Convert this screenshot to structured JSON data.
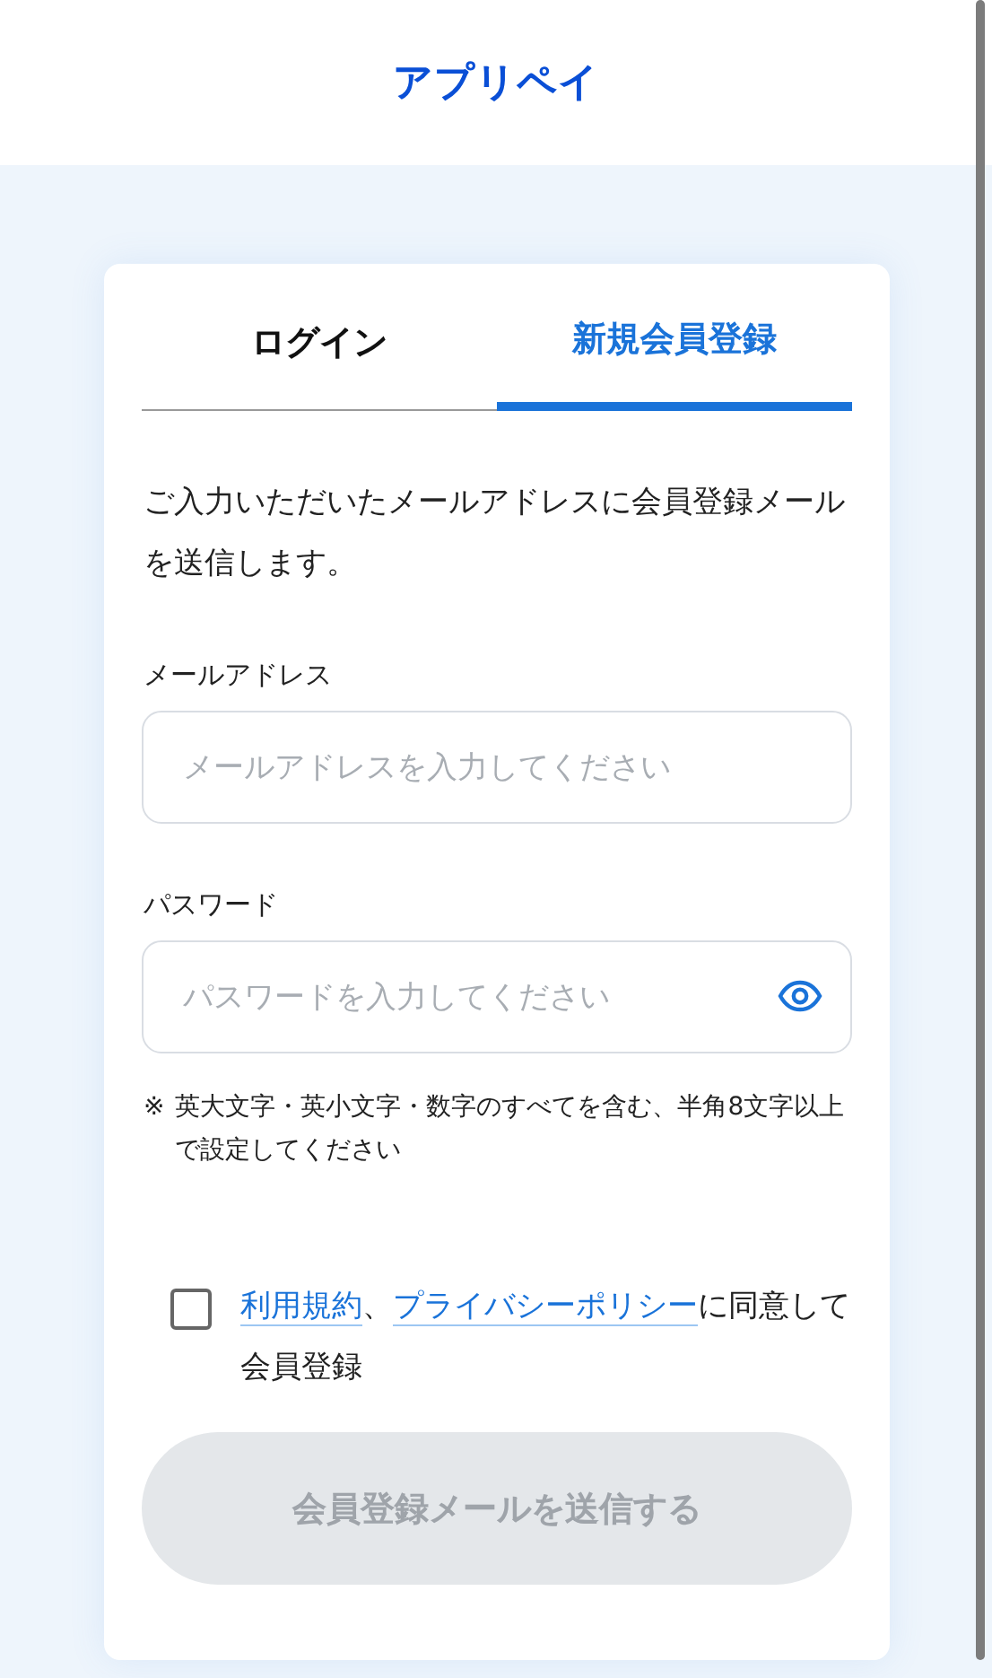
{
  "header": {
    "logo": "アプリペイ"
  },
  "tabs": [
    {
      "label": "ログイン",
      "selected": false
    },
    {
      "label": "新規会員登録",
      "selected": true
    }
  ],
  "intro": "ご入力いただいたメールアドレスに会員登録メールを送信します。",
  "fields": [
    {
      "label": "メールアドレス",
      "placeholder": "メールアドレスを入力してください",
      "kind": "email"
    },
    {
      "label": "パスワード",
      "placeholder": "パスワードを入力してください",
      "kind": "password"
    }
  ],
  "note": {
    "mark": "※",
    "text": "英大文字・英小文字・数字のすべてを含む、半角8文字以上で設定してください"
  },
  "consent": {
    "checked": false,
    "parts": [
      {
        "kind": "link",
        "text": "利用規約"
      },
      {
        "kind": "text",
        "text": "、"
      },
      {
        "kind": "link",
        "text": "プライバシーポリシー"
      },
      {
        "kind": "text",
        "text": "に同意して会員登録"
      }
    ]
  },
  "submit": {
    "label": "会員登録メールを送信する",
    "disabled": true
  }
}
